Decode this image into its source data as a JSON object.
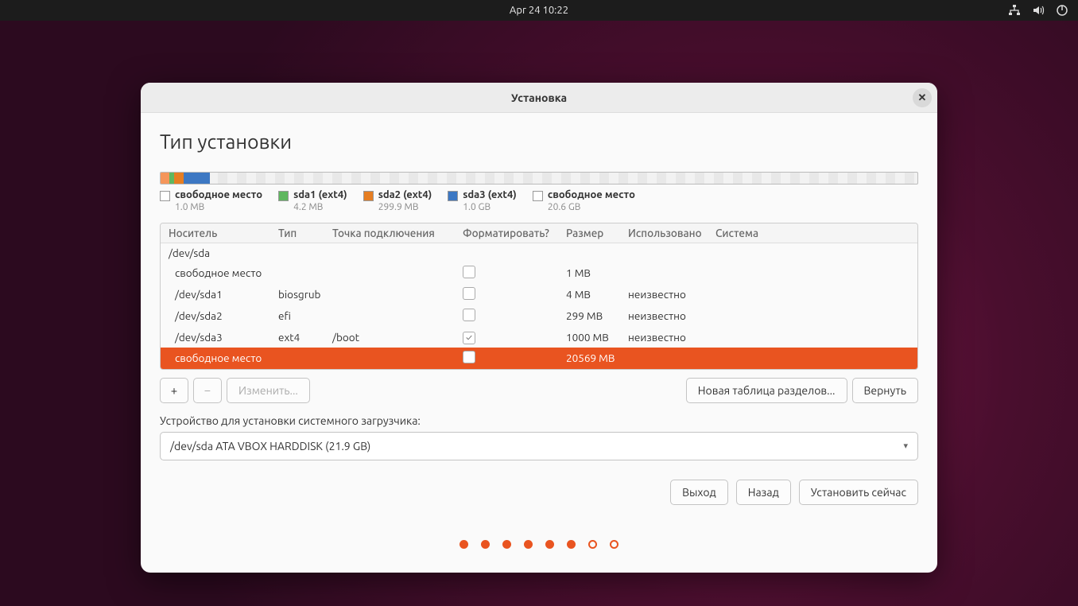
{
  "topbar": {
    "datetime": "Apr 24  10:22"
  },
  "window": {
    "title": "Установка",
    "heading": "Тип установки"
  },
  "legend": [
    {
      "name": "свободное место",
      "size": "1.0 MB",
      "cls": "free"
    },
    {
      "name": "sda1 (ext4)",
      "size": "4.2 MB",
      "cls": "sda1"
    },
    {
      "name": "sda2 (ext4)",
      "size": "299.9 MB",
      "cls": "sda2"
    },
    {
      "name": "sda3 (ext4)",
      "size": "1.0 GB",
      "cls": "sda3"
    },
    {
      "name": "свободное место",
      "size": "20.6 GB",
      "cls": "free"
    }
  ],
  "columns": {
    "device": "Носитель",
    "type": "Тип",
    "mount": "Точка подключения",
    "format": "Форматировать?",
    "size": "Размер",
    "used": "Использовано",
    "system": "Система"
  },
  "disk": "/dev/sda",
  "rows": [
    {
      "device": "свободное место",
      "type": "",
      "mount": "",
      "format": false,
      "size": "1 MB",
      "used": "",
      "selected": false
    },
    {
      "device": "/dev/sda1",
      "type": "biosgrub",
      "mount": "",
      "format": false,
      "size": "4 MB",
      "used": "неизвестно",
      "selected": false
    },
    {
      "device": "/dev/sda2",
      "type": "efi",
      "mount": "",
      "format": false,
      "size": "299 MB",
      "used": "неизвестно",
      "selected": false
    },
    {
      "device": "/dev/sda3",
      "type": "ext4",
      "mount": "/boot",
      "format": true,
      "size": "1000 MB",
      "used": "неизвестно",
      "selected": false
    },
    {
      "device": "свободное место",
      "type": "",
      "mount": "",
      "format": false,
      "size": "20569 MB",
      "used": "",
      "selected": true
    }
  ],
  "toolbar": {
    "add": "+",
    "remove": "−",
    "change": "Изменить...",
    "newtable": "Новая таблица разделов...",
    "revert": "Вернуть"
  },
  "bootloader": {
    "label": "Устройство для установки системного загрузчика:",
    "value": "/dev/sda   ATA VBOX HARDDISK (21.9 GB)"
  },
  "nav": {
    "quit": "Выход",
    "back": "Назад",
    "install": "Установить сейчас"
  },
  "progress": {
    "current": 6,
    "total": 8
  }
}
